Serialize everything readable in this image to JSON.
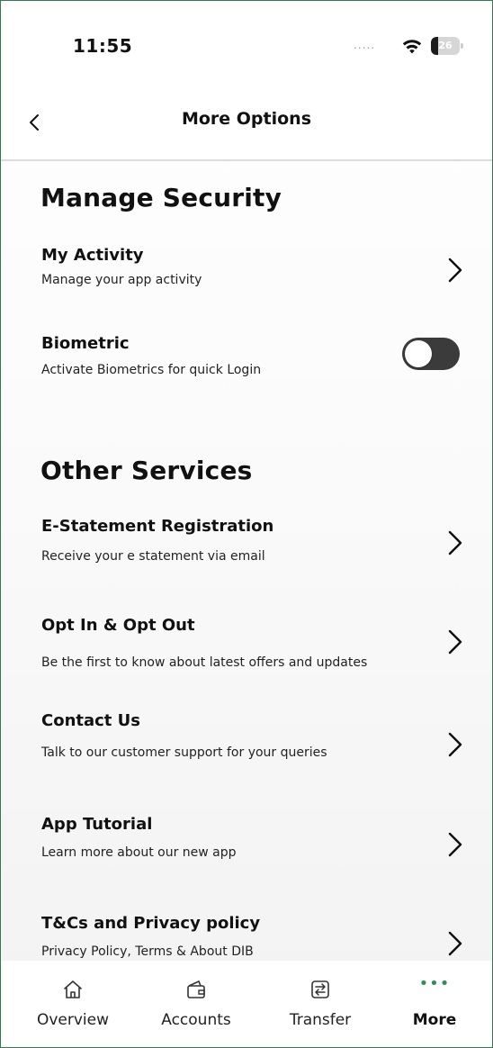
{
  "status_bar": {
    "time": "11:55",
    "signal_dots": ".....",
    "battery_level": 26,
    "battery_text": "26"
  },
  "header": {
    "title": "More Options"
  },
  "sections": [
    {
      "title": "Manage Security"
    },
    {
      "title": "Other Services"
    }
  ],
  "security_items": [
    {
      "title": "My Activity",
      "subtitle": "Manage your app activity"
    },
    {
      "title": "Biometric",
      "subtitle": "Activate Biometrics for quick Login",
      "toggle_on": false
    }
  ],
  "service_items": [
    {
      "title": "E-Statement Registration",
      "subtitle": "Receive your e statement via email"
    },
    {
      "title": "Opt In & Opt Out",
      "subtitle": "Be the first to know about latest offers and updates"
    },
    {
      "title": "Contact Us",
      "subtitle": "Talk to our customer support for your queries"
    },
    {
      "title": "App Tutorial",
      "subtitle": "Learn more about our new app"
    },
    {
      "title": "T&Cs and Privacy policy",
      "subtitle": "Privacy Policy, Terms & About DIB"
    }
  ],
  "tab_bar": {
    "tabs": [
      {
        "label": "Overview",
        "icon": "home-icon"
      },
      {
        "label": "Accounts",
        "icon": "wallet-icon"
      },
      {
        "label": "Transfer",
        "icon": "transfer-icon"
      },
      {
        "label": "More",
        "icon": "more-dots-icon",
        "glyph": "•••"
      }
    ],
    "active": "More"
  },
  "colors": {
    "accent": "#2f8f55",
    "toggle_off": "#3b3b3b",
    "divider": "#dcdcdc"
  }
}
